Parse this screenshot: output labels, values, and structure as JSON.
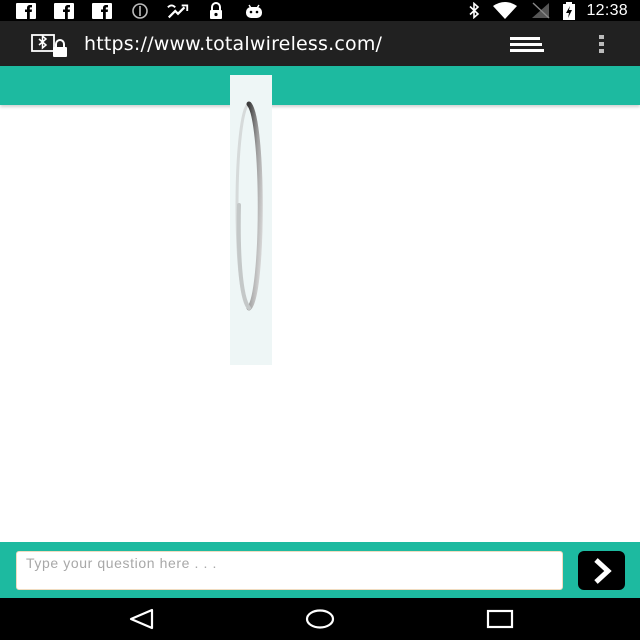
{
  "status_bar": {
    "time": "12:38",
    "left_icons": [
      "facebook-icon",
      "facebook-icon",
      "facebook-icon",
      "sync-circle-icon",
      "missed-call-icon",
      "lock-icon",
      "android-icon"
    ],
    "right_icons": [
      "bluetooth-icon",
      "wifi-icon",
      "no-signal-icon",
      "battery-charging-icon"
    ]
  },
  "browser": {
    "url": "https://www.totalwireless.com/"
  },
  "loader": {
    "state": "loading"
  },
  "chat": {
    "placeholder": "Type your question here . . .",
    "value": ""
  },
  "nav_bar": {
    "buttons": [
      "back-icon",
      "home-icon",
      "recents-icon"
    ]
  },
  "colors": {
    "accent": "#1dbaa0",
    "status_bar": "#000000",
    "browser_bar": "#212121",
    "loader_bg": "#eef6f6",
    "page_bg": "#ffffff"
  }
}
